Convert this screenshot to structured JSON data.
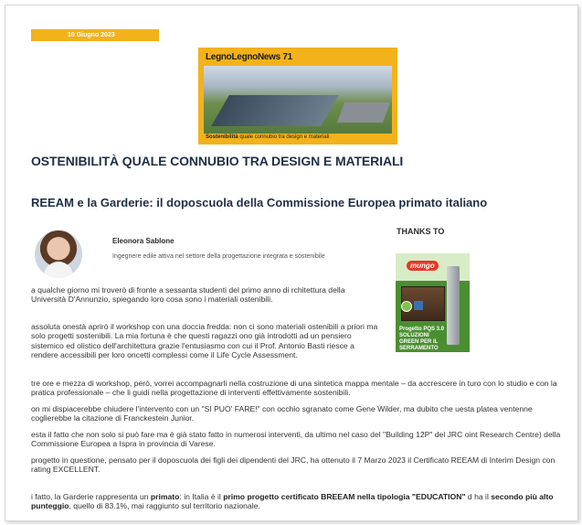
{
  "date": "10 Giugno 2023",
  "cover": {
    "title": "LegnoLegnoNews 71",
    "caption_bold": "Sostenibilità",
    "caption_rest": " quale connubio tra design e materiali"
  },
  "article": {
    "section_title": "OSTENIBILITÀ QUALE CONNUBIO TRA DESIGN E MATERIALI",
    "title": "REEAM e la Garderie: il doposcuola della Commissione Europea primato italiano"
  },
  "author": {
    "name": "Eleonora Sablone",
    "bio": "Ingegnere edile attiva nel settore della progettazione integrata e sostenibile"
  },
  "sidebar": {
    "thanks_label": "THANKS TO",
    "sponsor_logo": "mungo",
    "sponsor_text": "Progetto PQS 3.0 SOLUZIONI GREEN PER IL SERRAMENTO"
  },
  "paragraphs": {
    "p1": "a qualche giorno mi troverò di fronte a sessanta studenti del primo anno di rchitettura della Università D'Annunzio, spiegando loro cosa sono i materiali ostenibili.",
    "p2": " assoluta onestà aprirò il workshop con una doccia fredda: non ci sono materiali ostenibili a priori ma solo progetti sostenibili. La mia fortuna è che questi ragazzi ono già introdotti ad un pensiero sistemico ed olistico dell'architettura grazie l'entusiasmo con cui il Prof. Antonio Basti riesce a rendere accessibili per loro oncetti complessi come il Life Cycle Assessment.",
    "p3": "tre ore e mezza di workshop, però, vorrei accompagnarli nella costruzione di una sintetica mappa mentale – da accrescere in turo con lo studio e con la pratica professionale – che li guidi nella progettazione di interventi effettivamente sostenibili.",
    "p4": "on mi dispiacerebbe chiudere l'intervento con un \"SI PUO' FARE!\" con occhio sgranato come Gene Wilder, ma dubito che uesta platea ventenne coglierebbe la citazione di Franckestein Junior.",
    "p5": "esta il fatto che non solo si può fare ma è già stato fatto in numerosi interventi, da ultimo nel caso del \"Building 12P\" del JRC oint Research Centre) della Commissione Europea a Ispra in provincia di Varese.",
    "p6": " progetto in questione, pensato per il doposcuola dei figli dei dipendenti del JRC, ha ottenuto il 7 Marzo 2023 il Certificato REEAM di Interim Design con rating EXCELLENT.",
    "p7_a": "i fatto, la Garderie rappresenta un ",
    "p7_b": "primato",
    "p7_c": ": in Italia è il ",
    "p7_d": "primo progetto certificato BREEAM nella tipologia \"EDUCATION\"",
    "p7_e": " d ha il ",
    "p7_f": "secondo più alto punteggio",
    "p7_g": ", quello di 83.1%, mai raggiunto sul territorio nazionale."
  },
  "colors": {
    "accent": "#f2b21b",
    "heading": "#1f2f45",
    "sponsor_green": "#4a8e32"
  }
}
